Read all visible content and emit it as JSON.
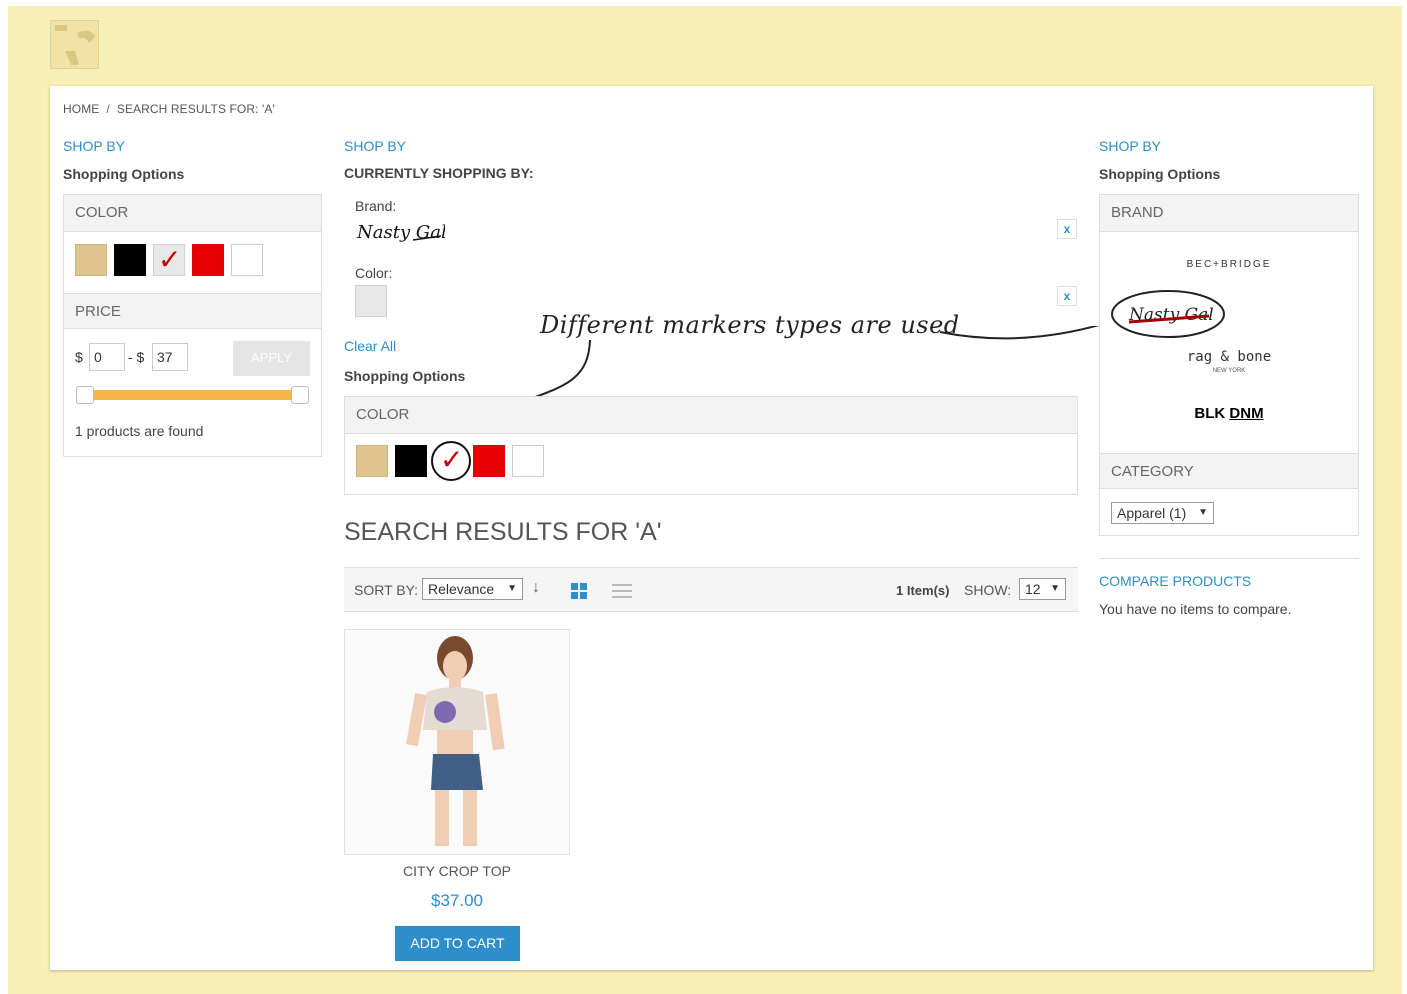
{
  "breadcrumb": {
    "home": "HOME",
    "separator": "/",
    "current": "SEARCH RESULTS FOR: 'A'"
  },
  "left_sidebar": {
    "shop_by": "SHOP BY",
    "shopping_options": "Shopping Options",
    "color_header": "COLOR",
    "price_header": "PRICE",
    "price_currency": "$",
    "price_from": "0",
    "price_dash": "- $",
    "price_to": "37",
    "apply_label": "APPLY",
    "products_found": "1 products are found"
  },
  "center": {
    "shop_by": "SHOP BY",
    "currently_shopping_by": "CURRENTLY SHOPPING BY:",
    "brand_label": "Brand:",
    "brand_value": "Nasty Gal",
    "color_label": "Color:",
    "remove_label": "x",
    "clear_all": "Clear All",
    "shopping_options": "Shopping Options",
    "color_header": "COLOR",
    "annotation": "Different markers types are used",
    "results_title": "SEARCH RESULTS FOR 'A'",
    "toolbar": {
      "sort_by_label": "SORT BY:",
      "sort_value": "Relevance",
      "item_count": "1 Item(s)",
      "show_label": "SHOW:",
      "show_value": "12"
    },
    "product": {
      "name": "CITY CROP TOP",
      "price": "$37.00",
      "add_to_cart": "ADD TO CART"
    }
  },
  "right_sidebar": {
    "shop_by": "SHOP BY",
    "shopping_options": "Shopping Options",
    "brand_header": "BRAND",
    "brands": {
      "bec_bridge": "BEC+BRIDGE",
      "nasty_gal": "Nasty Gal",
      "rag_bone": "rag & bone",
      "rag_bone_sub": "NEW YORK",
      "blk": "BLK",
      "dnm": "DNM"
    },
    "category_header": "CATEGORY",
    "category_value": "Apparel (1)",
    "compare_title": "COMPARE PRODUCTS",
    "compare_text": "You have no items to compare."
  },
  "colors": {
    "accent": "#2d8ec9",
    "background": "#f8efb6",
    "slider": "#f5b34a",
    "check": "#c40000"
  }
}
